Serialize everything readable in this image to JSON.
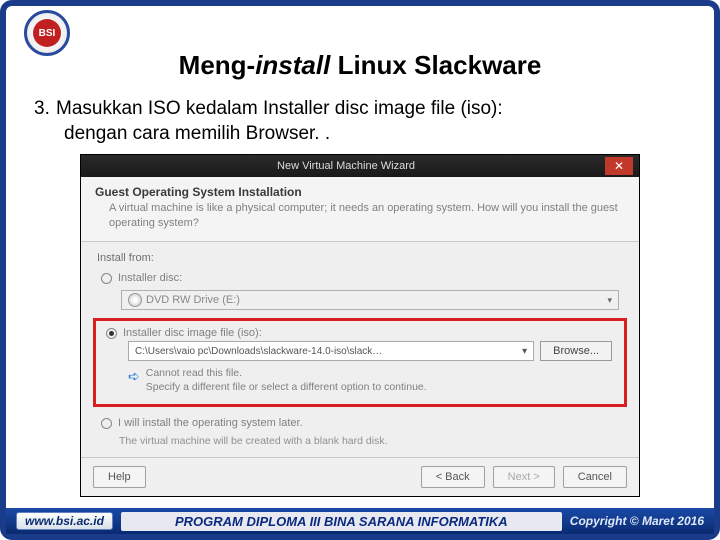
{
  "slide": {
    "title_pre": "Meng-",
    "title_italic": "install",
    "title_post": " Linux Slackware",
    "step_number": "3.",
    "step_line1": "Masukkan ISO kedalam Installer disc image file (iso):",
    "step_line2": "dengan cara memilih Browser. ."
  },
  "wizard": {
    "window_title": "New Virtual Machine Wizard",
    "close": "✕",
    "head_title": "Guest Operating System Installation",
    "head_sub": "A virtual machine is like a physical computer; it needs an operating system. How will you install the guest operating system?",
    "install_from": "Install from:",
    "opt_disc": "Installer disc:",
    "disc_drive": "DVD RW Drive (E:)",
    "opt_iso": "Installer disc image file (iso):",
    "iso_path": "C:\\Users\\vaio pc\\Downloads\\slackware-14.0-iso\\slack…",
    "browse": "Browse...",
    "warn1": "Cannot read this file.",
    "warn2": "Specify a different file or select a different option to continue.",
    "opt_later": "I will install the operating system later.",
    "later_sub": "The virtual machine will be created with a blank hard disk.",
    "help": "Help",
    "back": "< Back",
    "next": "Next >",
    "cancel": "Cancel"
  },
  "footer": {
    "url": "www.bsi.ac.id",
    "program": "PROGRAM DIPLOMA III BINA SARANA INFORMATIKA",
    "copyright": "Copyright © Maret 2016"
  },
  "logo_text": "BSI"
}
